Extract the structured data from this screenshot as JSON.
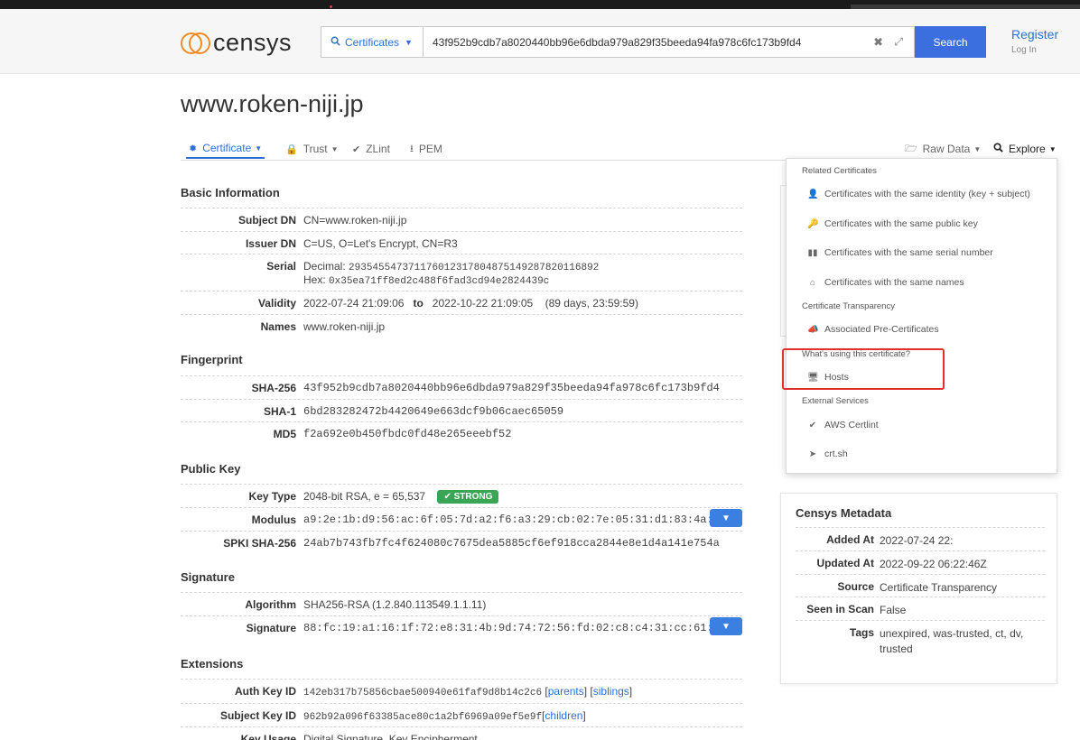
{
  "header": {
    "logo_text": "censys",
    "search_type": "Certificates",
    "search_query": "43f952b9cdb7a8020440bb96e6dbda979a829f35beeda94fa978c6fc173b9fd4",
    "search_button": "Search",
    "register": "Register",
    "login": "Log In"
  },
  "page_title": "www.roken-niji.jp",
  "tabs": {
    "certificate": "Certificate",
    "trust": "Trust",
    "zlint": "ZLint",
    "pem": "PEM",
    "raw_data": "Raw Data",
    "explore": "Explore"
  },
  "basic_info": {
    "title": "Basic Information",
    "subject_dn_label": "Subject DN",
    "subject_dn": "CN=www.roken-niji.jp",
    "issuer_dn_label": "Issuer DN",
    "issuer_dn": "C=US, O=Let's Encrypt, CN=R3",
    "serial_label": "Serial",
    "serial_decimal_label": "Decimal:",
    "serial_decimal": "293545547371176012317804875149287820116892",
    "serial_hex_label": "Hex:",
    "serial_hex": "0x35ea71ff8ed2c488f6fad3cd94e2824439c",
    "validity_label": "Validity",
    "validity_start": "2022-07-24 21:09:06",
    "validity_to": "to",
    "validity_end": "2022-10-22 21:09:05",
    "validity_duration": "(89 days, 23:59:59)",
    "names_label": "Names",
    "names": "www.roken-niji.jp"
  },
  "fingerprint": {
    "title": "Fingerprint",
    "sha256_label": "SHA-256",
    "sha256": "43f952b9cdb7a8020440bb96e6dbda979a829f35beeda94fa978c6fc173b9fd4",
    "sha1_label": "SHA-1",
    "sha1": "6bd283282472b4420649e663dcf9b06caec65059",
    "md5_label": "MD5",
    "md5": "f2a692e0b450fbdc0fd48e265eeebf52"
  },
  "public_key": {
    "title": "Public Key",
    "key_type_label": "Key Type",
    "key_type": "2048-bit RSA, e = 65,537",
    "strength": "STRONG",
    "modulus_label": "Modulus",
    "modulus": "a9:2e:1b:d9:56:ac:6f:05:7d:a2:f6:a3:29:cb:02:7e:05:31:d1:83:4a:",
    "spki_label": "SPKI SHA-256",
    "spki": "24ab7b743fb7fc4f624080c7675dea5885cf6ef918cca2844e8e1d4a141e754a"
  },
  "signature": {
    "title": "Signature",
    "algorithm_label": "Algorithm",
    "algorithm": "SHA256-RSA (1.2.840.113549.1.1.11)",
    "signature_label": "Signature",
    "signature": "88:fc:19:a1:16:1f:72:e8:31:4b:9d:74:72:56:fd:02:c8:c4:31:cc:61:"
  },
  "extensions": {
    "title": "Extensions",
    "auth_key_label": "Auth Key ID",
    "auth_key": "142eb317b75856cbae500940e61faf9d8b14c2c6",
    "parents": "parents",
    "siblings": "siblings",
    "subject_key_label": "Subject Key ID",
    "subject_key": "962b92a096f63385ace80c1a2bf6969a09ef5e9f",
    "children": "children",
    "key_usage_label": "Key Usage",
    "key_usage": "Digital Signature, Key Encipherment"
  },
  "explore_menu": {
    "related_header": "Related Certificates",
    "same_identity": "Certificates with the same identity (key + subject)",
    "same_key": "Certificates with the same public key",
    "same_serial": "Certificates with the same serial number",
    "same_names": "Certificates with the same names",
    "ct_header": "Certificate Transparency",
    "pre_certs": "Associated Pre-Certificates",
    "using_header": "What's using this certificate?",
    "hosts": "Hosts",
    "external_header": "External Services",
    "aws": "AWS Certlint",
    "crtsh": "crt.sh"
  },
  "metadata": {
    "title": "Censys Metadata",
    "added_label": "Added At",
    "added": "2022-07-24 22:",
    "updated_label": "Updated At",
    "updated": "2022-09-22 06:22:46Z",
    "source_label": "Source",
    "source": "Certificate Transparency",
    "seen_label": "Seen in Scan",
    "seen": "False",
    "tags_label": "Tags",
    "tags": "unexpired, was-trusted, ct, dv, trusted"
  },
  "colors": {
    "accent": "#3b6fe0",
    "link": "#2d6fd6",
    "brand_orange": "#f08a24",
    "strong_green": "#3aa655",
    "highlight_red": "#e0312c"
  }
}
